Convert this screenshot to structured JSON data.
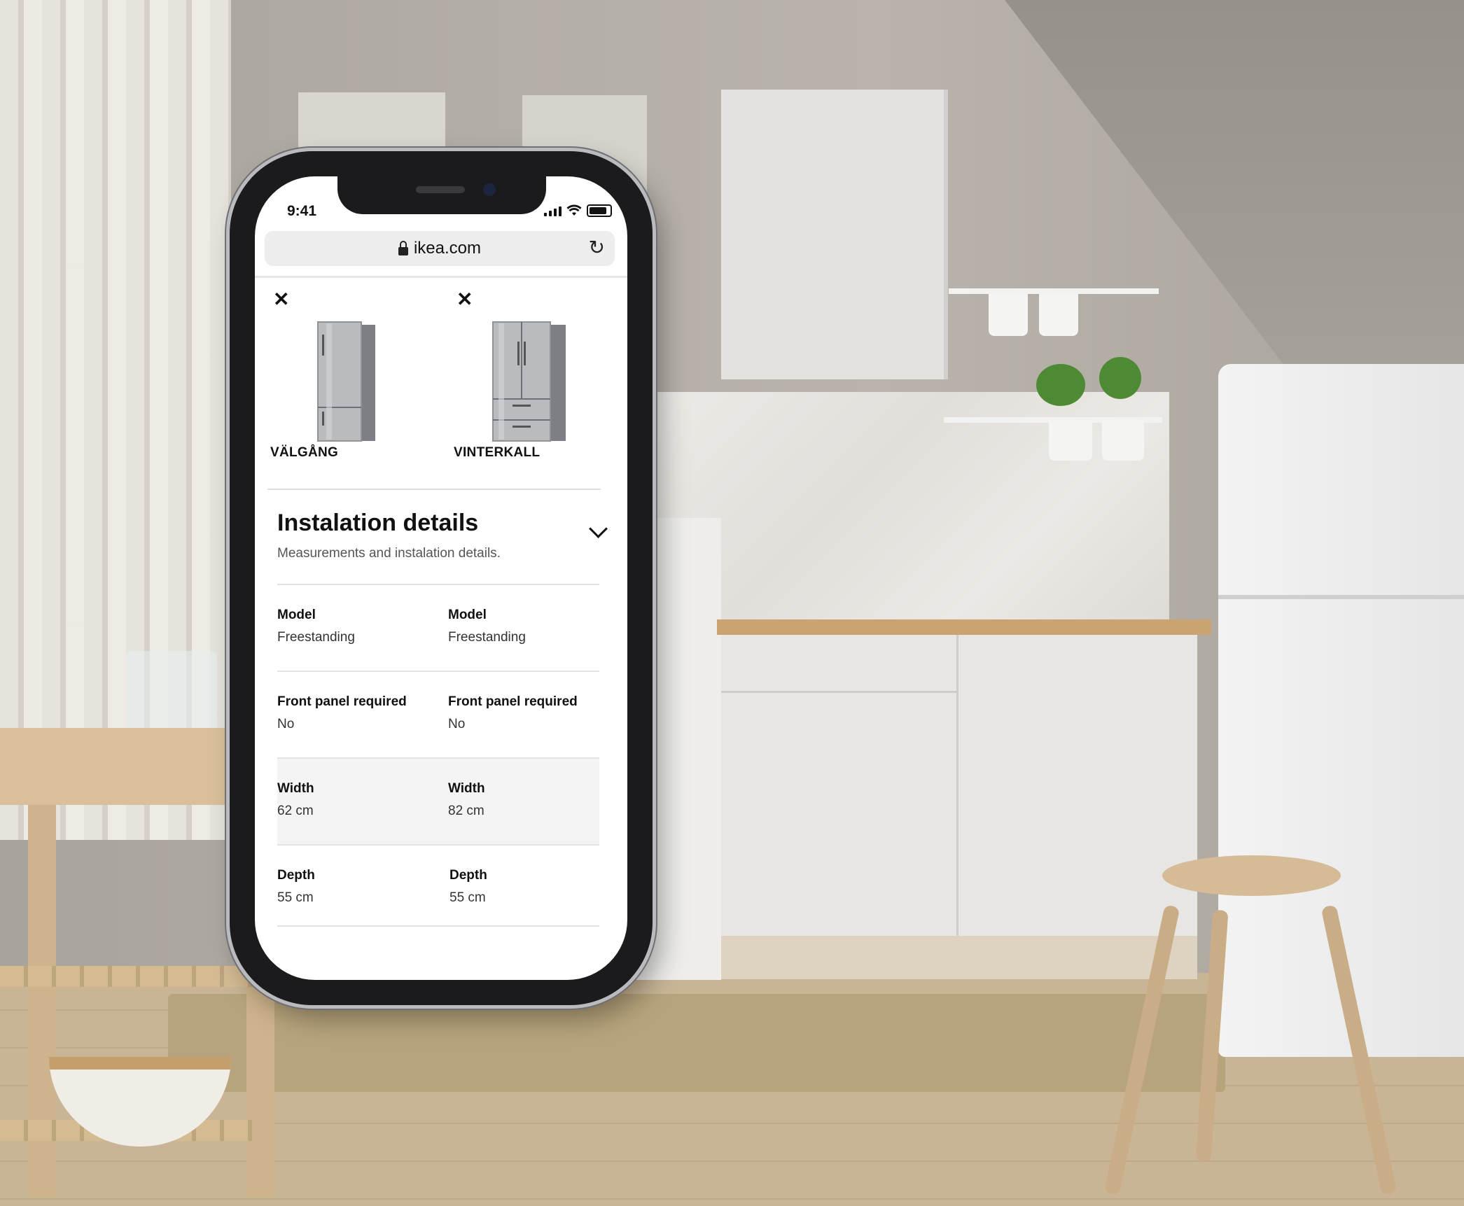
{
  "status_bar": {
    "time": "9:41"
  },
  "browser": {
    "url": "ikea.com"
  },
  "compare": {
    "products": [
      {
        "name": "VÄLGÅNG",
        "image": "freestanding-fridge-freezer-image"
      },
      {
        "name": "VINTERKALL",
        "image": "french-door-fridge-image"
      }
    ]
  },
  "section": {
    "title": "Instalation details",
    "subtitle": "Measurements and instalation details.",
    "expand_icon": "chevron-down-icon"
  },
  "specs": [
    {
      "label": "Model",
      "values": [
        "Freestanding",
        "Freestanding"
      ]
    },
    {
      "label": "Front panel required",
      "values": [
        "No",
        "No"
      ]
    },
    {
      "label": "Width",
      "values": [
        "62 cm",
        "82 cm"
      ]
    },
    {
      "label": "Depth",
      "values": [
        "55 cm",
        "55 cm"
      ]
    }
  ],
  "colors": {
    "accent": "#111111",
    "row_highlight": "#f4f4f4"
  }
}
